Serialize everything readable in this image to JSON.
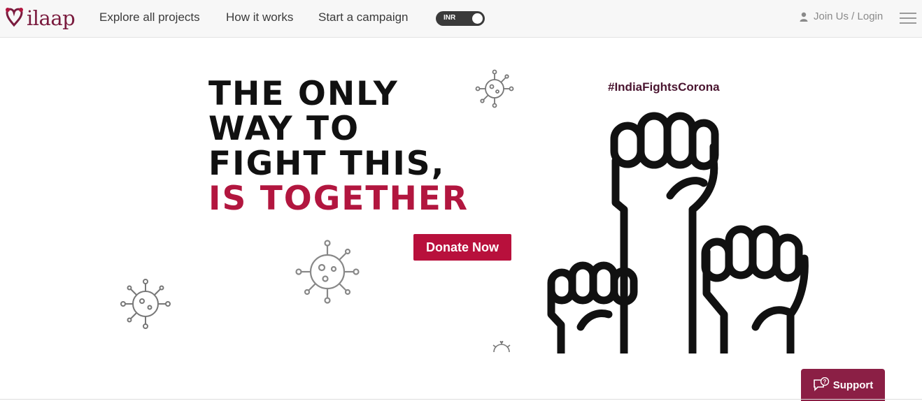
{
  "header": {
    "logo_text": "ilaap",
    "nav": [
      {
        "label": "Explore all projects"
      },
      {
        "label": "How it works"
      },
      {
        "label": "Start a campaign"
      }
    ],
    "currency_toggle": {
      "label": "INR"
    },
    "login_label": "Join Us / Login"
  },
  "banner": {
    "headline_lines": [
      "THE ONLY",
      "WAY TO",
      "FIGHT THIS,"
    ],
    "headline_accent": "IS TOGETHER",
    "donate_label": "Donate Now",
    "hashtag": "#IndiaFightsCorona"
  },
  "support": {
    "label": "Support"
  },
  "colors": {
    "brand": "#7a1b3e",
    "accent": "#b2163f",
    "donate_bg": "#b8103c",
    "support_bg": "#8b1f45",
    "header_bg": "#f7f7f7"
  }
}
